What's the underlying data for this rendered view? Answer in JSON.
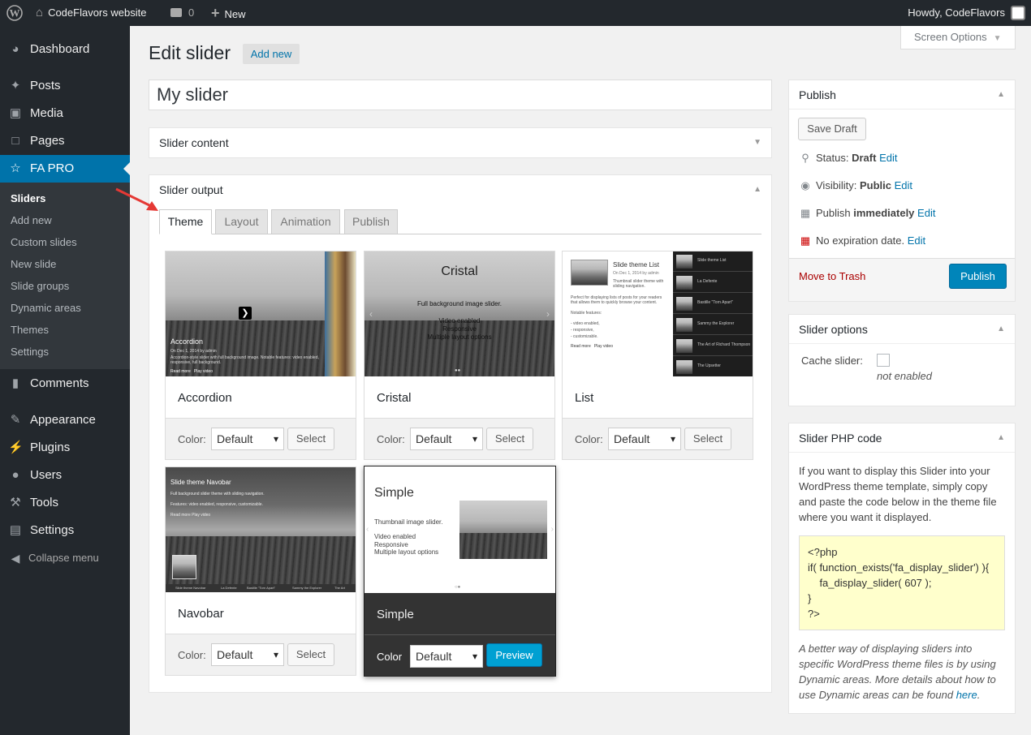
{
  "topbar": {
    "site": "CodeFlavors website",
    "comments": "0",
    "new": "New",
    "howdy": "Howdy, CodeFlavors"
  },
  "sidebar": {
    "items": [
      "Dashboard",
      "Posts",
      "Media",
      "Pages",
      "FA PRO",
      "Comments",
      "Appearance",
      "Plugins",
      "Users",
      "Tools",
      "Settings",
      "Collapse menu"
    ],
    "submenu": [
      "Sliders",
      "Add new",
      "Custom slides",
      "New slide",
      "Slide groups",
      "Dynamic areas",
      "Themes",
      "Settings"
    ]
  },
  "screen_options": "Screen Options",
  "page": {
    "title": "Edit slider",
    "add_new": "Add new",
    "slider_title": "My slider"
  },
  "slider_content": "Slider content",
  "slider_output": {
    "title": "Slider output",
    "tabs": [
      "Theme",
      "Layout",
      "Animation",
      "Publish"
    ]
  },
  "themes": [
    {
      "name": "Accordion",
      "color_label": "Color:",
      "color": "Default",
      "button": "Select"
    },
    {
      "name": "Cristal",
      "color_label": "Color:",
      "color": "Default",
      "button": "Select"
    },
    {
      "name": "List",
      "color_label": "Color:",
      "color": "Default",
      "button": "Select"
    },
    {
      "name": "Navobar",
      "color_label": "Color:",
      "color": "Default",
      "button": "Select"
    },
    {
      "name": "Simple",
      "color_label": "Color",
      "color": "Default",
      "button": "Preview"
    }
  ],
  "thumbs": {
    "accordion": {
      "title": "Accordion",
      "meta": "On Dec 1, 2014 by admin",
      "desc": "Accordion-style slider with full background image. Notable features: video enabled, responsive, full background.",
      "links": "Read more   Play video"
    },
    "cristal": {
      "title": "Cristal",
      "line1": "Full background image slider.",
      "line2": "Video enabled",
      "line3": "Responsive",
      "line4": "Multiple layout options"
    },
    "list": {
      "title": "Slide theme List",
      "meta": "On Dec 1, 2014 by admin",
      "desc": "Thumbnail slider theme with sliding navigation.",
      "desc2": "Perfect for displaying lists of posts for your readers that allows them to quickly browse your content.",
      "features": "Notable features:",
      "f1": "- video enabled,",
      "f2": "- responsive,",
      "f3": "- customizable.",
      "links": "Read more   Play video",
      "nav": [
        "Slide theme List",
        "La Defente",
        "Bastille \"Torn Apart\"",
        "Sammy the Explorer",
        "The Art of Richard Thompson",
        "The Upsetter"
      ]
    },
    "navobar": {
      "title": "Slide theme Navobar",
      "d1": "Full background slider theme with sliding navigation.",
      "d2": "Features: video enabled, responsive, customizable.",
      "d3": "Read more  Play video",
      "nav": [
        "Slide theme Navobar",
        "La Defente",
        "Bastille \"Torn Apart\"",
        "Sammy the Explorer",
        "The Art"
      ]
    },
    "simple": {
      "title": "Simple",
      "d1": "Thumbnail image slider.",
      "d2": "Video enabled",
      "d3": "Responsive",
      "d4": "Multiple layout options"
    }
  },
  "publish": {
    "title": "Publish",
    "save_draft": "Save Draft",
    "status_label": "Status:",
    "status": "Draft",
    "visibility_label": "Visibility:",
    "visibility": "Public",
    "publish_label": "Publish",
    "publish_when": "immediately",
    "expiration": "No expiration date.",
    "edit": "Edit",
    "trash": "Move to Trash",
    "publish_btn": "Publish"
  },
  "slider_options": {
    "title": "Slider options",
    "cache_label": "Cache slider:",
    "cache_status": "not enabled"
  },
  "php": {
    "title": "Slider PHP code",
    "desc": "If you want to display this Slider into your WordPress theme template, simply copy and paste the code below in the theme file where you want it displayed.",
    "code": [
      "<?php",
      "if( function_exists('fa_display_slider') ){",
      "    fa_display_slider( 607 );",
      "}",
      "?>"
    ],
    "note": "A better way of displaying sliders into specific WordPress theme files is by using Dynamic areas. More details about how to use Dynamic areas can be found",
    "here": "here",
    "dot": "."
  },
  "colors": {
    "accent": "#0073aa",
    "primary_button": "#0085ba",
    "trash": "#a00",
    "code_bg": "#ffffcc",
    "arrow": "#e53935"
  }
}
